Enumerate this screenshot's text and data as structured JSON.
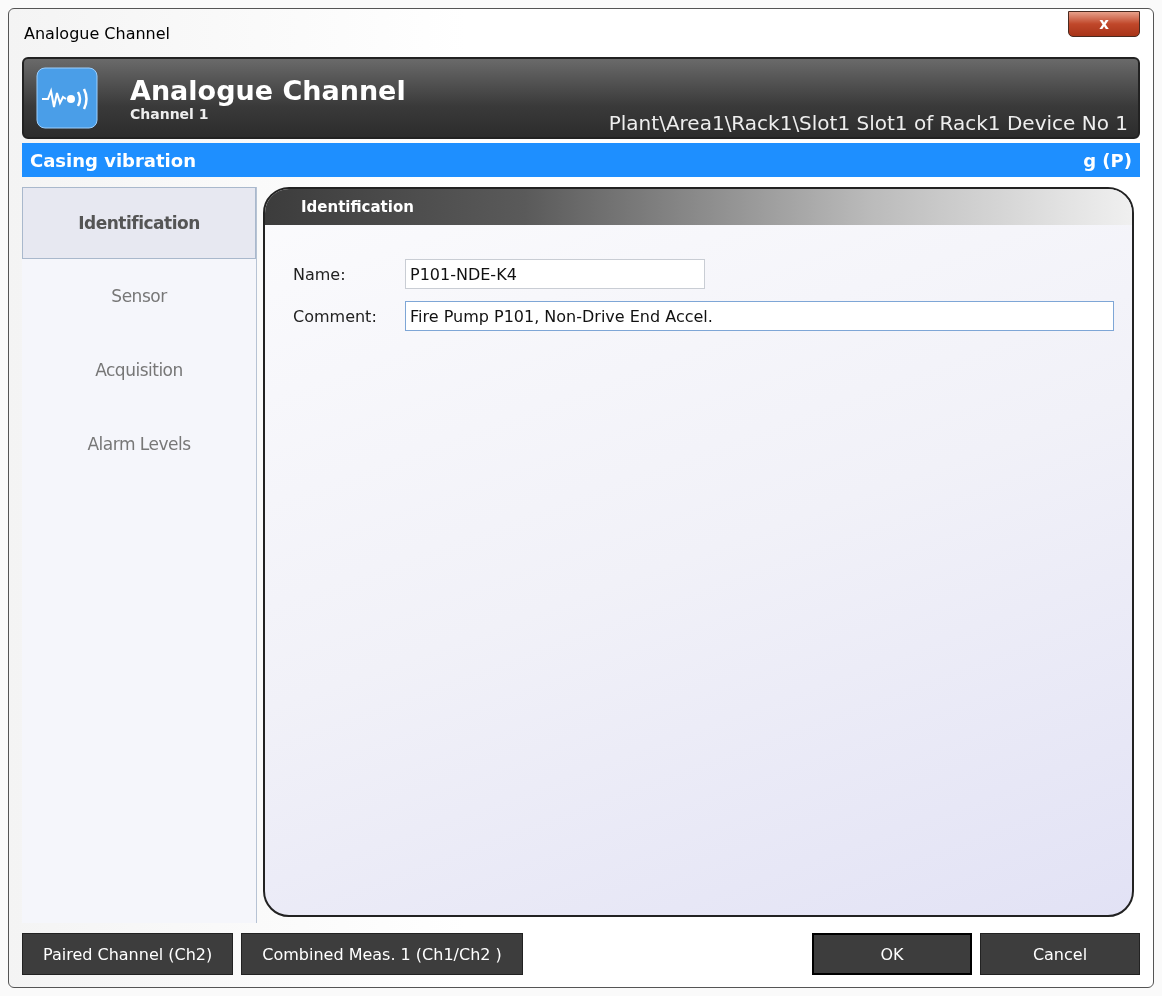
{
  "window": {
    "title": "Analogue Channel",
    "close_label": "x"
  },
  "header": {
    "title": "Analogue Channel",
    "subtitle": "Channel 1",
    "path": "Plant\\Area1\\Rack1\\Slot1 Slot1 of Rack1 Device No 1"
  },
  "banner": {
    "label": "Casing vibration",
    "unit": "g (P)"
  },
  "tabs": [
    {
      "label": "Identification",
      "selected": true
    },
    {
      "label": "Sensor",
      "selected": false
    },
    {
      "label": "Acquisition",
      "selected": false
    },
    {
      "label": "Alarm Levels",
      "selected": false
    }
  ],
  "panel": {
    "title": "Identification",
    "fields": [
      {
        "label": "Name:",
        "value": "P101-NDE-K4",
        "focused": false
      },
      {
        "label": "Comment:",
        "value": "Fire Pump P101, Non-Drive End Accel.",
        "focused": true
      }
    ]
  },
  "buttons_left": [
    "Paired Channel (Ch2)",
    "Combined Meas. 1 (Ch1/Ch2 )"
  ],
  "buttons_right": [
    {
      "label": "OK",
      "default": true
    },
    {
      "label": "Cancel",
      "default": false
    }
  ]
}
